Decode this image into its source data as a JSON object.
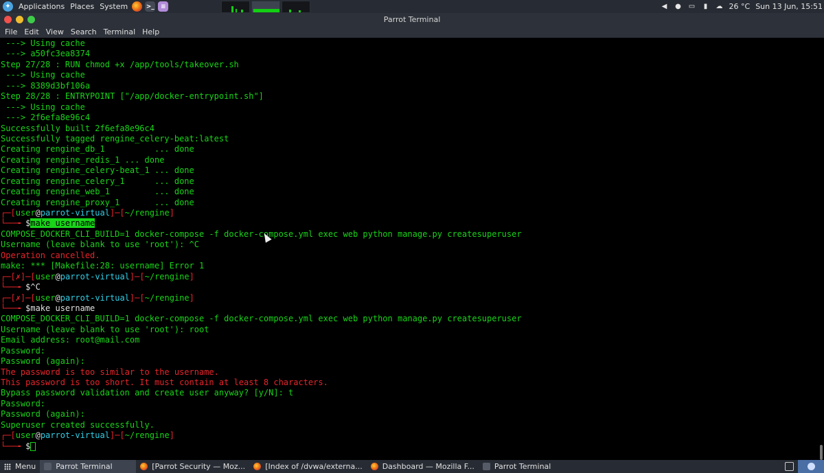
{
  "top_panel": {
    "applications": "Applications",
    "places": "Places",
    "system": "System",
    "weather": "26 °C",
    "clock": "Sun 13 Jun, 15:51"
  },
  "window": {
    "title": "Parrot Terminal",
    "menus": [
      "File",
      "Edit",
      "View",
      "Search",
      "Terminal",
      "Help"
    ]
  },
  "terminal": {
    "lines": [
      [
        {
          "t": " ---> Using cache",
          "c": "g"
        }
      ],
      [
        {
          "t": " ---> a50fc3ea8374",
          "c": "g"
        }
      ],
      [
        {
          "t": "Step 27/28 : RUN chmod +x /app/tools/takeover.sh",
          "c": "g"
        }
      ],
      [
        {
          "t": " ---> Using cache",
          "c": "g"
        }
      ],
      [
        {
          "t": " ---> 8389d3bf106a",
          "c": "g"
        }
      ],
      [
        {
          "t": "Step 28/28 : ENTRYPOINT [\"/app/docker-entrypoint.sh\"]",
          "c": "g"
        }
      ],
      [
        {
          "t": " ---> Using cache",
          "c": "g"
        }
      ],
      [
        {
          "t": " ---> 2f6efa8e96c4",
          "c": "g"
        }
      ],
      [
        {
          "t": "Successfully built 2f6efa8e96c4",
          "c": "g"
        }
      ],
      [
        {
          "t": "Successfully tagged rengine_celery-beat:latest",
          "c": "g"
        }
      ],
      [
        {
          "t": "Creating rengine_db_1          ... done",
          "c": "g"
        }
      ],
      [
        {
          "t": "Creating rengine_redis_1 ... done",
          "c": "g"
        }
      ],
      [
        {
          "t": "Creating rengine_celery-beat_1 ... done",
          "c": "g"
        }
      ],
      [
        {
          "t": "Creating rengine_celery_1      ... done",
          "c": "g"
        }
      ],
      [
        {
          "t": "Creating rengine_web_1         ... done",
          "c": "g"
        }
      ],
      [
        {
          "t": "Creating rengine_proxy_1       ... done",
          "c": "g"
        }
      ],
      [
        {
          "t": "┌─[",
          "c": "r"
        },
        {
          "t": "user",
          "c": "g"
        },
        {
          "t": "@",
          "c": "w"
        },
        {
          "t": "parrot-virtual",
          "c": "c"
        },
        {
          "t": "]─[",
          "c": "r"
        },
        {
          "t": "~/rengine",
          "c": "g"
        },
        {
          "t": "]",
          "c": "r"
        }
      ],
      [
        {
          "t": "└──╼ ",
          "c": "r"
        },
        {
          "t": "$",
          "c": "w"
        },
        {
          "t": "make username",
          "c": "sel"
        }
      ],
      [
        {
          "t": "COMPOSE_DOCKER_CLI_BUILD=1 docker-compose -f docker-compose.yml exec web python manage.py createsuperuser",
          "c": "g"
        }
      ],
      [
        {
          "t": "Username (leave blank to use 'root'): ^C",
          "c": "g"
        }
      ],
      [
        {
          "t": "Operation cancelled.",
          "c": "r"
        }
      ],
      [
        {
          "t": "make: *** [Makefile:28: username] Error 1",
          "c": "g"
        }
      ],
      [
        {
          "t": "┌─[",
          "c": "r"
        },
        {
          "t": "✗",
          "c": "r"
        },
        {
          "t": "]─[",
          "c": "r"
        },
        {
          "t": "user",
          "c": "g"
        },
        {
          "t": "@",
          "c": "w"
        },
        {
          "t": "parrot-virtual",
          "c": "c"
        },
        {
          "t": "]─[",
          "c": "r"
        },
        {
          "t": "~/rengine",
          "c": "g"
        },
        {
          "t": "]",
          "c": "r"
        }
      ],
      [
        {
          "t": "└──╼ ",
          "c": "r"
        },
        {
          "t": "$^C",
          "c": "w"
        }
      ],
      [
        {
          "t": "┌─[",
          "c": "r"
        },
        {
          "t": "✗",
          "c": "r"
        },
        {
          "t": "]─[",
          "c": "r"
        },
        {
          "t": "user",
          "c": "g"
        },
        {
          "t": "@",
          "c": "w"
        },
        {
          "t": "parrot-virtual",
          "c": "c"
        },
        {
          "t": "]─[",
          "c": "r"
        },
        {
          "t": "~/rengine",
          "c": "g"
        },
        {
          "t": "]",
          "c": "r"
        }
      ],
      [
        {
          "t": "└──╼ ",
          "c": "r"
        },
        {
          "t": "$make username",
          "c": "w"
        }
      ],
      [
        {
          "t": "COMPOSE_DOCKER_CLI_BUILD=1 docker-compose -f docker-compose.yml exec web python manage.py createsuperuser",
          "c": "g"
        }
      ],
      [
        {
          "t": "Username (leave blank to use 'root'): root",
          "c": "g"
        }
      ],
      [
        {
          "t": "Email address: root@mail.com",
          "c": "g"
        }
      ],
      [
        {
          "t": "Password:",
          "c": "g"
        }
      ],
      [
        {
          "t": "Password (again):",
          "c": "g"
        }
      ],
      [
        {
          "t": "The password is too similar to the username.",
          "c": "r"
        }
      ],
      [
        {
          "t": "This password is too short. It must contain at least 8 characters.",
          "c": "r"
        }
      ],
      [
        {
          "t": "Bypass password validation and create user anyway? [y/N]: t",
          "c": "g"
        }
      ],
      [
        {
          "t": "Password:",
          "c": "g"
        }
      ],
      [
        {
          "t": "Password (again):",
          "c": "g"
        }
      ],
      [
        {
          "t": "Superuser created successfully.",
          "c": "g"
        }
      ],
      [
        {
          "t": "┌─[",
          "c": "r"
        },
        {
          "t": "user",
          "c": "g"
        },
        {
          "t": "@",
          "c": "w"
        },
        {
          "t": "parrot-virtual",
          "c": "c"
        },
        {
          "t": "]─[",
          "c": "r"
        },
        {
          "t": "~/rengine",
          "c": "g"
        },
        {
          "t": "]",
          "c": "r"
        }
      ],
      [
        {
          "t": "└──╼ ",
          "c": "r"
        },
        {
          "t": "$",
          "c": "w"
        },
        {
          "t": "",
          "c": "cursor"
        }
      ]
    ]
  },
  "taskbar": {
    "menu": "Menu",
    "tasks": [
      {
        "label": "Parrot Terminal",
        "icon": "terminal-icon",
        "active": true
      },
      {
        "label": "[Parrot Security — Moz...",
        "icon": "firefox-icon",
        "active": false
      },
      {
        "label": "[Index of /dvwa/externa...",
        "icon": "firefox-icon",
        "active": false
      },
      {
        "label": "Dashboard — Mozilla F...",
        "icon": "firefox-icon",
        "active": false
      },
      {
        "label": "Parrot Terminal",
        "icon": "terminal-icon",
        "active": false
      }
    ]
  }
}
